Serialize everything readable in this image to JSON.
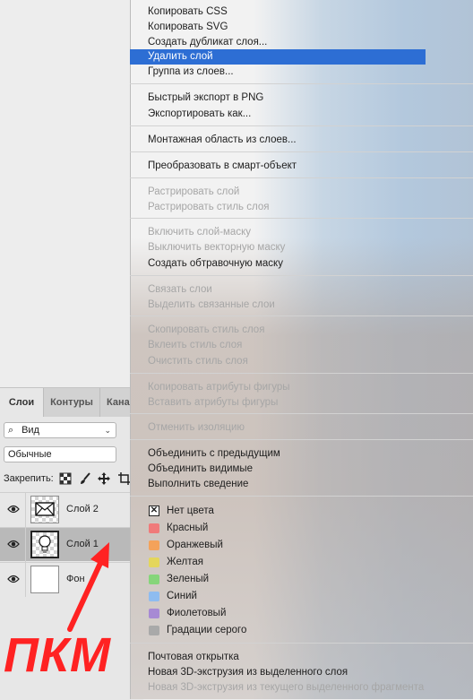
{
  "layers_panel": {
    "tabs": [
      "Слои",
      "Контуры",
      "Кана"
    ],
    "filter": {
      "kind_label": "Вид"
    },
    "blend_mode": "Обычные",
    "lock_label": "Закрепить:",
    "layers": [
      {
        "name": "Слой 2",
        "visible": true,
        "selected": false,
        "thumb": "envelope-icon"
      },
      {
        "name": "Слой 1",
        "visible": true,
        "selected": true,
        "thumb": "lightbulb-icon"
      },
      {
        "name": "Фон",
        "visible": true,
        "selected": false,
        "thumb": "white"
      }
    ]
  },
  "context_menu": {
    "groups": [
      [
        {
          "label": "Копировать CSS",
          "enabled": true
        },
        {
          "label": "Копировать SVG",
          "enabled": true
        },
        {
          "label": "Создать дубликат слоя...",
          "enabled": true
        },
        {
          "label": "Удалить слой",
          "enabled": true,
          "highlighted": true
        },
        {
          "label": "Группа из слоев...",
          "enabled": true
        }
      ],
      [
        {
          "label": "Быстрый экспорт в PNG",
          "enabled": true
        },
        {
          "label": "Экспортировать как...",
          "enabled": true
        }
      ],
      [
        {
          "label": "Монтажная область из слоев...",
          "enabled": true
        }
      ],
      [
        {
          "label": "Преобразовать в смарт-объект",
          "enabled": true
        }
      ],
      [
        {
          "label": "Растрировать слой",
          "enabled": false
        },
        {
          "label": "Растрировать стиль слоя",
          "enabled": false
        }
      ],
      [
        {
          "label": "Включить слой-маску",
          "enabled": false
        },
        {
          "label": "Выключить векторную маску",
          "enabled": false
        },
        {
          "label": "Создать обтравочную маску",
          "enabled": true
        }
      ],
      [
        {
          "label": "Связать слои",
          "enabled": false
        },
        {
          "label": "Выделить связанные слои",
          "enabled": false
        }
      ],
      [
        {
          "label": "Скопировать стиль слоя",
          "enabled": false
        },
        {
          "label": "Вклеить стиль слоя",
          "enabled": false
        },
        {
          "label": "Очистить стиль слоя",
          "enabled": false
        }
      ],
      [
        {
          "label": "Копировать атрибуты фигуры",
          "enabled": false
        },
        {
          "label": "Вставить атрибуты фигуры",
          "enabled": false
        }
      ],
      [
        {
          "label": "Отменить изоляцию",
          "enabled": false
        }
      ],
      [
        {
          "label": "Объединить с предыдущим",
          "enabled": true
        },
        {
          "label": "Объединить видимые",
          "enabled": true
        },
        {
          "label": "Выполнить сведение",
          "enabled": true
        }
      ],
      [
        {
          "label": "Нет цвета",
          "enabled": true,
          "swatch": "none"
        },
        {
          "label": "Красный",
          "enabled": true,
          "swatch": "#f07a7a"
        },
        {
          "label": "Оранжевый",
          "enabled": true,
          "swatch": "#f4a25a"
        },
        {
          "label": "Желтая",
          "enabled": true,
          "swatch": "#e4d65c"
        },
        {
          "label": "Зеленый",
          "enabled": true,
          "swatch": "#86d57a"
        },
        {
          "label": "Синий",
          "enabled": true,
          "swatch": "#8ebcf0"
        },
        {
          "label": "Фиолетовый",
          "enabled": true,
          "swatch": "#a78ad4"
        },
        {
          "label": "Градации серого",
          "enabled": true,
          "swatch": "#a9a9a9"
        }
      ],
      [
        {
          "label": "Почтовая открытка",
          "enabled": true
        },
        {
          "label": "Новая 3D-экструзия из выделенного слоя",
          "enabled": true
        },
        {
          "label": "Новая 3D-экструзия из текущего выделенного фрагмента",
          "enabled": false
        }
      ]
    ]
  },
  "annotation": {
    "text": "ПКМ",
    "color": "#ff2222"
  },
  "colors": {
    "highlight": "#2d6ed4"
  }
}
